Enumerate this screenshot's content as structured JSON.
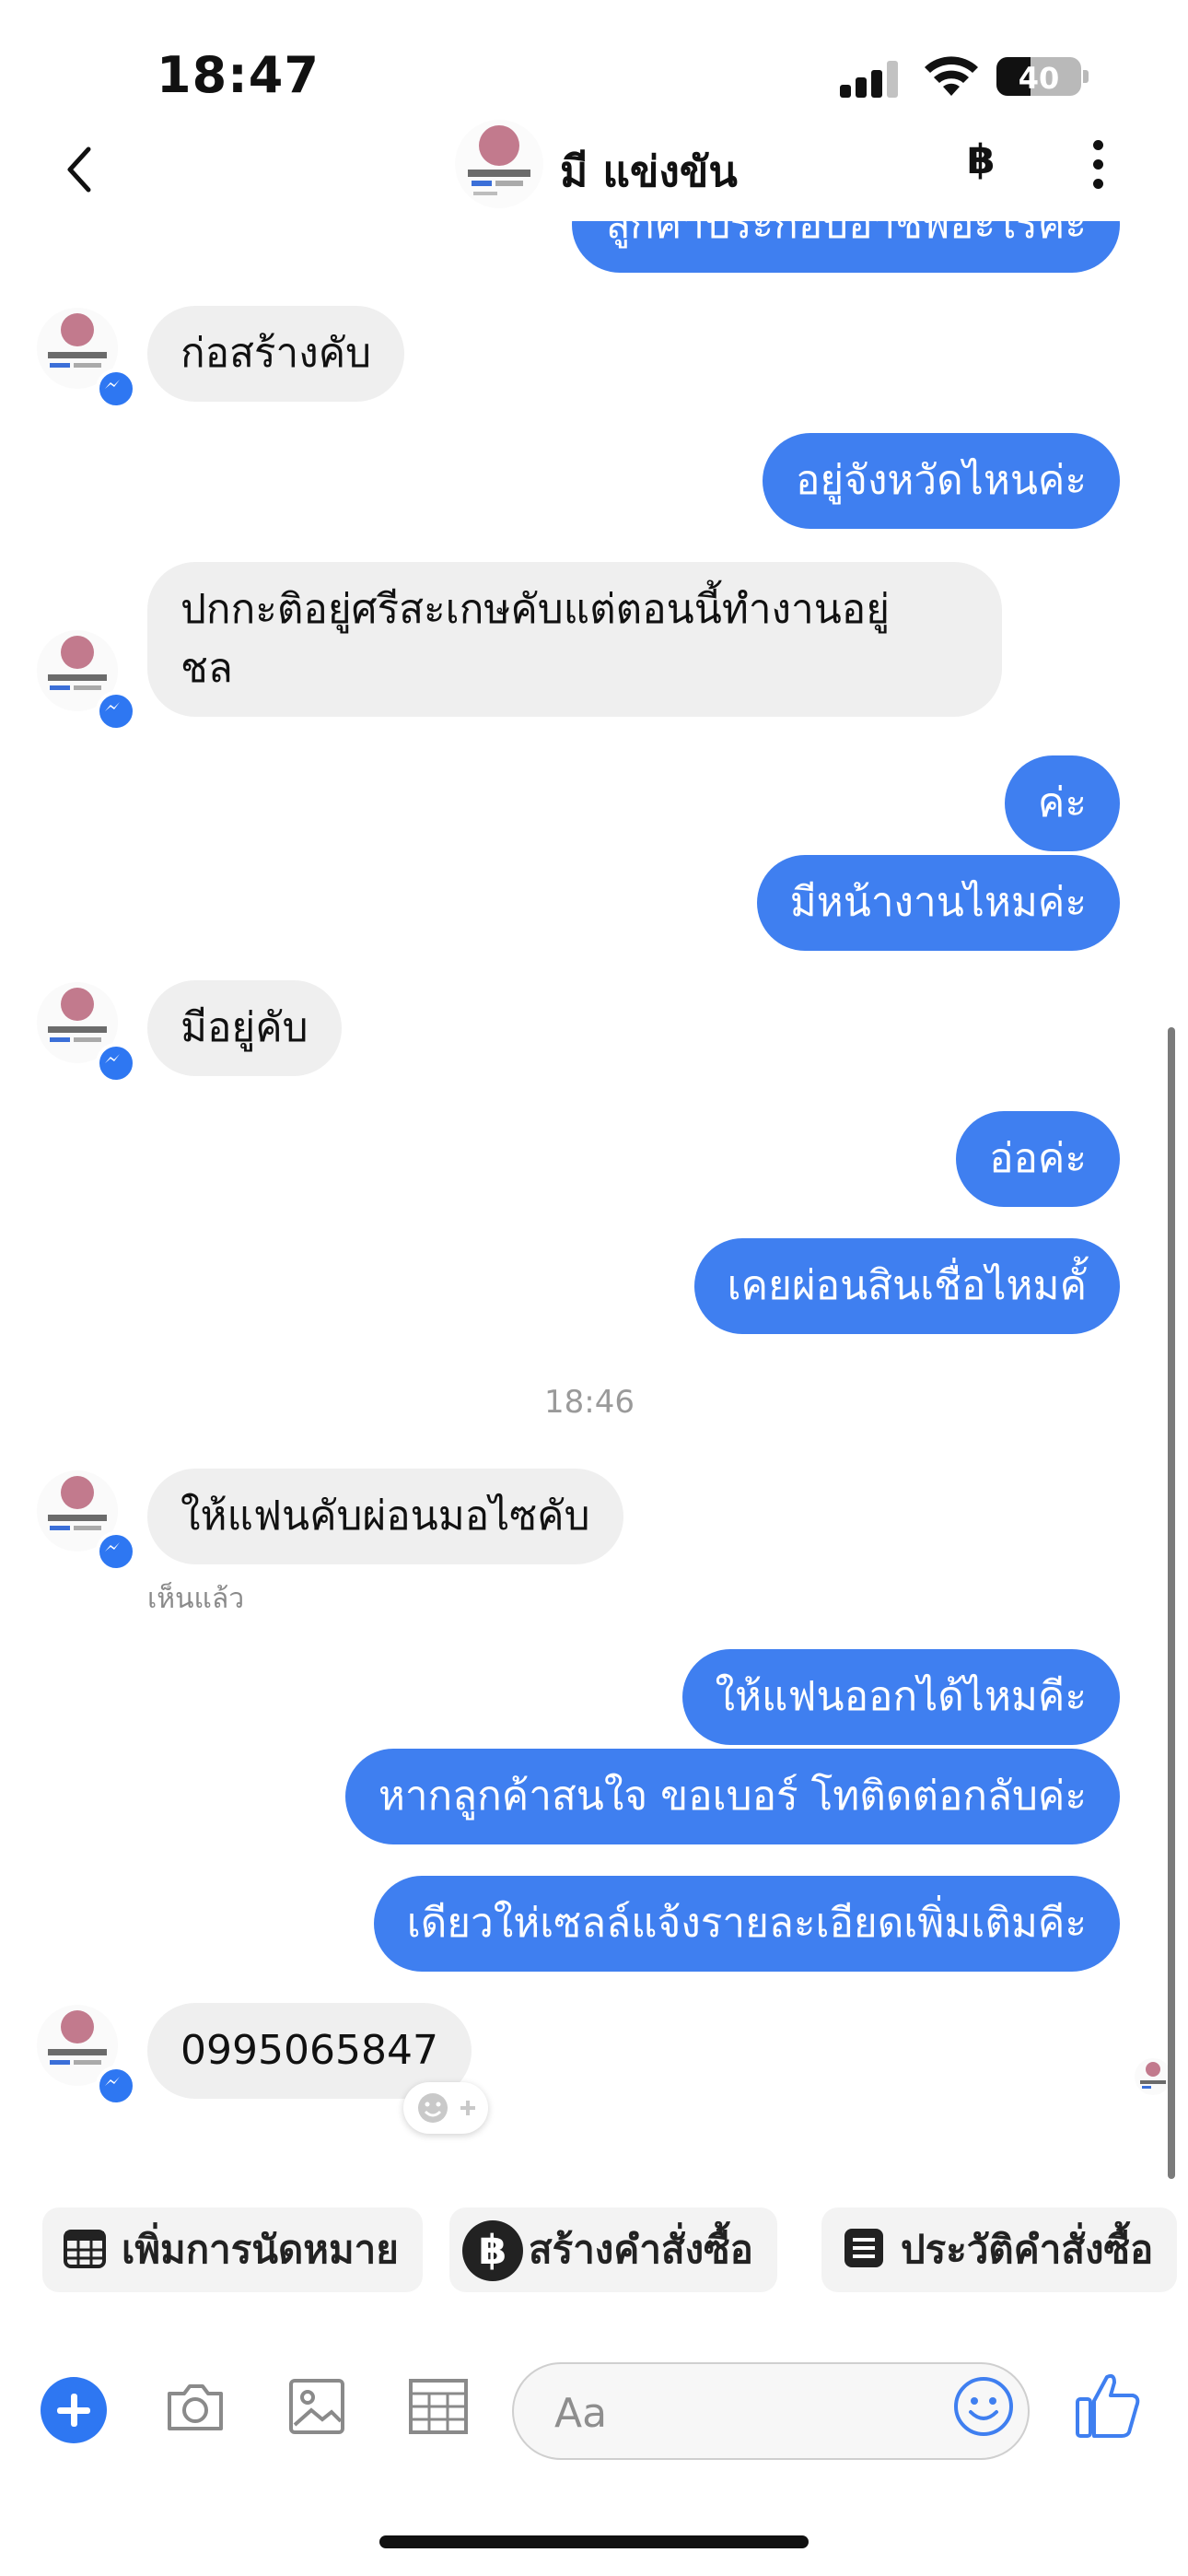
{
  "status_bar": {
    "time": "18:47",
    "battery": "40",
    "battery_level": 0.4
  },
  "header": {
    "contact_name": "มี แข่งขัน",
    "baht_icon": "฿",
    "more_icon": "more-vertical-icon"
  },
  "chat": {
    "partial_top": "ลูกค้าประกอบอาชีพอะไรคะ",
    "m1": "ก่อสร้างคับ",
    "m2": "อยู่จังหวัดไหนค่ะ",
    "m3_line1": "ปกกะติอยู่ศรีสะเกษคับแต่ตอนนี้ทำงานอยู่",
    "m3_line2": "ชล",
    "m4": "ค่ะ",
    "m5": "มีหน้างานไหมค่ะ",
    "m6": "มีอยู่คับ",
    "m7": "อ่อค่ะ",
    "m8": "เคยผ่อนสินเชื่อไหมคั้",
    "timestamp": "18:46",
    "m9": "ให้แฟนคับผ่อนมอไซคับ",
    "seen_label": "เห็นแล้ว",
    "m10": "ให้แฟนออกได้ไหมคีะ",
    "m11": "หากลูกค้าสนใจ ขอเบอร์ โทติดต่อกลับค่ะ",
    "m12": "เดียวให่เซลล์แจ้งรายละเอียดเพิ่มเติมคีะ",
    "m13": "0995065847"
  },
  "quick_actions": [
    {
      "label": "เพิ่มการนัดหมาย",
      "icon": "calendar-icon"
    },
    {
      "label": "สร้างคำสั่งซื้อ",
      "icon": "baht-icon"
    },
    {
      "label": "ประวัติคำสั่งซื้อ",
      "icon": "order-history-icon"
    }
  ],
  "composer": {
    "placeholder": "Aa"
  },
  "colors": {
    "accent": "#3f7ff0",
    "incoming_bubble": "#efefef",
    "outgoing_text": "#ffffff"
  }
}
